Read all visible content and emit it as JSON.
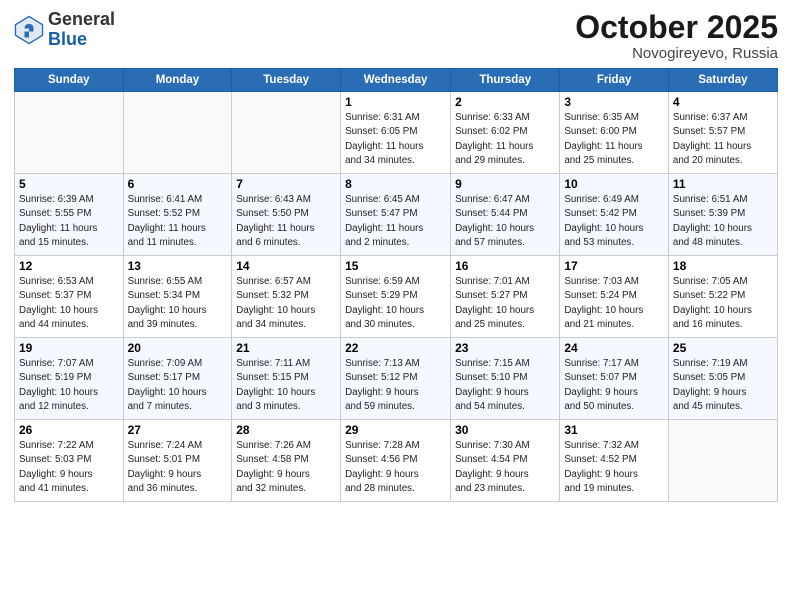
{
  "logo": {
    "general": "General",
    "blue": "Blue"
  },
  "header": {
    "month": "October 2025",
    "location": "Novogireyevo, Russia"
  },
  "weekdays": [
    "Sunday",
    "Monday",
    "Tuesday",
    "Wednesday",
    "Thursday",
    "Friday",
    "Saturday"
  ],
  "weeks": [
    [
      {
        "day": "",
        "info": ""
      },
      {
        "day": "",
        "info": ""
      },
      {
        "day": "",
        "info": ""
      },
      {
        "day": "1",
        "info": "Sunrise: 6:31 AM\nSunset: 6:05 PM\nDaylight: 11 hours\nand 34 minutes."
      },
      {
        "day": "2",
        "info": "Sunrise: 6:33 AM\nSunset: 6:02 PM\nDaylight: 11 hours\nand 29 minutes."
      },
      {
        "day": "3",
        "info": "Sunrise: 6:35 AM\nSunset: 6:00 PM\nDaylight: 11 hours\nand 25 minutes."
      },
      {
        "day": "4",
        "info": "Sunrise: 6:37 AM\nSunset: 5:57 PM\nDaylight: 11 hours\nand 20 minutes."
      }
    ],
    [
      {
        "day": "5",
        "info": "Sunrise: 6:39 AM\nSunset: 5:55 PM\nDaylight: 11 hours\nand 15 minutes."
      },
      {
        "day": "6",
        "info": "Sunrise: 6:41 AM\nSunset: 5:52 PM\nDaylight: 11 hours\nand 11 minutes."
      },
      {
        "day": "7",
        "info": "Sunrise: 6:43 AM\nSunset: 5:50 PM\nDaylight: 11 hours\nand 6 minutes."
      },
      {
        "day": "8",
        "info": "Sunrise: 6:45 AM\nSunset: 5:47 PM\nDaylight: 11 hours\nand 2 minutes."
      },
      {
        "day": "9",
        "info": "Sunrise: 6:47 AM\nSunset: 5:44 PM\nDaylight: 10 hours\nand 57 minutes."
      },
      {
        "day": "10",
        "info": "Sunrise: 6:49 AM\nSunset: 5:42 PM\nDaylight: 10 hours\nand 53 minutes."
      },
      {
        "day": "11",
        "info": "Sunrise: 6:51 AM\nSunset: 5:39 PM\nDaylight: 10 hours\nand 48 minutes."
      }
    ],
    [
      {
        "day": "12",
        "info": "Sunrise: 6:53 AM\nSunset: 5:37 PM\nDaylight: 10 hours\nand 44 minutes."
      },
      {
        "day": "13",
        "info": "Sunrise: 6:55 AM\nSunset: 5:34 PM\nDaylight: 10 hours\nand 39 minutes."
      },
      {
        "day": "14",
        "info": "Sunrise: 6:57 AM\nSunset: 5:32 PM\nDaylight: 10 hours\nand 34 minutes."
      },
      {
        "day": "15",
        "info": "Sunrise: 6:59 AM\nSunset: 5:29 PM\nDaylight: 10 hours\nand 30 minutes."
      },
      {
        "day": "16",
        "info": "Sunrise: 7:01 AM\nSunset: 5:27 PM\nDaylight: 10 hours\nand 25 minutes."
      },
      {
        "day": "17",
        "info": "Sunrise: 7:03 AM\nSunset: 5:24 PM\nDaylight: 10 hours\nand 21 minutes."
      },
      {
        "day": "18",
        "info": "Sunrise: 7:05 AM\nSunset: 5:22 PM\nDaylight: 10 hours\nand 16 minutes."
      }
    ],
    [
      {
        "day": "19",
        "info": "Sunrise: 7:07 AM\nSunset: 5:19 PM\nDaylight: 10 hours\nand 12 minutes."
      },
      {
        "day": "20",
        "info": "Sunrise: 7:09 AM\nSunset: 5:17 PM\nDaylight: 10 hours\nand 7 minutes."
      },
      {
        "day": "21",
        "info": "Sunrise: 7:11 AM\nSunset: 5:15 PM\nDaylight: 10 hours\nand 3 minutes."
      },
      {
        "day": "22",
        "info": "Sunrise: 7:13 AM\nSunset: 5:12 PM\nDaylight: 9 hours\nand 59 minutes."
      },
      {
        "day": "23",
        "info": "Sunrise: 7:15 AM\nSunset: 5:10 PM\nDaylight: 9 hours\nand 54 minutes."
      },
      {
        "day": "24",
        "info": "Sunrise: 7:17 AM\nSunset: 5:07 PM\nDaylight: 9 hours\nand 50 minutes."
      },
      {
        "day": "25",
        "info": "Sunrise: 7:19 AM\nSunset: 5:05 PM\nDaylight: 9 hours\nand 45 minutes."
      }
    ],
    [
      {
        "day": "26",
        "info": "Sunrise: 7:22 AM\nSunset: 5:03 PM\nDaylight: 9 hours\nand 41 minutes."
      },
      {
        "day": "27",
        "info": "Sunrise: 7:24 AM\nSunset: 5:01 PM\nDaylight: 9 hours\nand 36 minutes."
      },
      {
        "day": "28",
        "info": "Sunrise: 7:26 AM\nSunset: 4:58 PM\nDaylight: 9 hours\nand 32 minutes."
      },
      {
        "day": "29",
        "info": "Sunrise: 7:28 AM\nSunset: 4:56 PM\nDaylight: 9 hours\nand 28 minutes."
      },
      {
        "day": "30",
        "info": "Sunrise: 7:30 AM\nSunset: 4:54 PM\nDaylight: 9 hours\nand 23 minutes."
      },
      {
        "day": "31",
        "info": "Sunrise: 7:32 AM\nSunset: 4:52 PM\nDaylight: 9 hours\nand 19 minutes."
      },
      {
        "day": "",
        "info": ""
      }
    ]
  ]
}
